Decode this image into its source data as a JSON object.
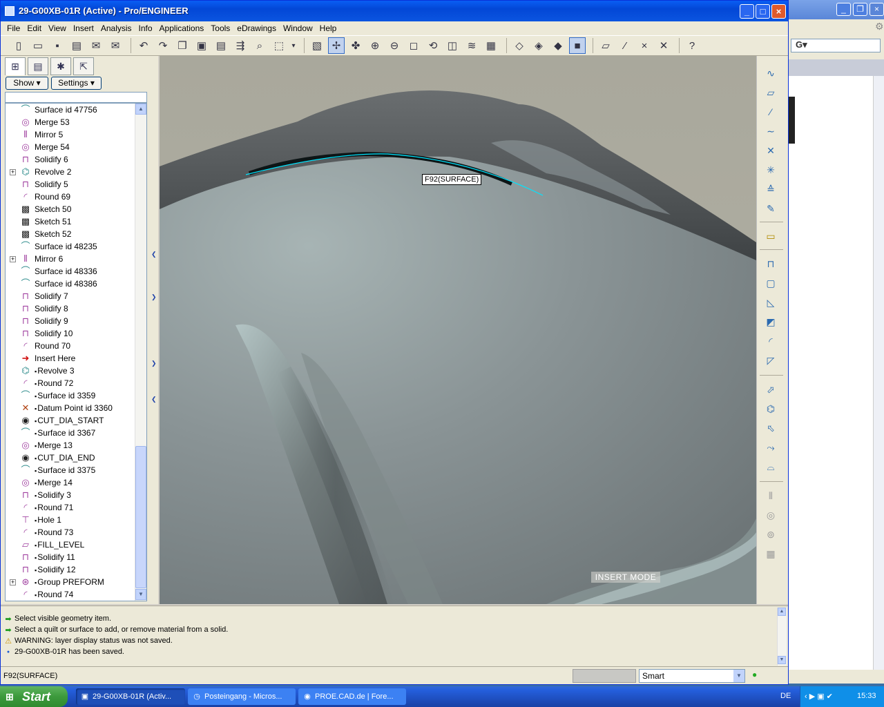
{
  "window": {
    "title": "29-G00XB-01R (Active) - Pro/ENGINEER"
  },
  "menu": [
    "File",
    "Edit",
    "View",
    "Insert",
    "Analysis",
    "Info",
    "Applications",
    "Tools",
    "eDrawings",
    "Window",
    "Help"
  ],
  "toolbar": {
    "icons": [
      "new-icon",
      "open-icon",
      "save-icon",
      "print-icon",
      "email-icon",
      "email-link-icon",
      "sep",
      "undo-icon",
      "redo-icon",
      "copy-icon",
      "paste-icon",
      "paste-special-icon",
      "regenerate-icon",
      "find-icon",
      "select-box-icon",
      "dropdown-icon",
      "sep",
      "repaint-icon",
      "spin-center-icon",
      "orient-icon",
      "zoom-in-icon",
      "zoom-out-icon",
      "refit-icon",
      "reorient-icon",
      "saved-views-icon",
      "layers-icon",
      "view-manager-icon",
      "sep",
      "wireframe-icon",
      "hidden-line-icon",
      "no-hidden-icon",
      "shading-icon",
      "sep",
      "datum-planes-icon",
      "datum-axes-icon",
      "datum-points-icon",
      "coordinate-systems-icon",
      "sep",
      "context-help-icon"
    ]
  },
  "left_panel": {
    "show_label": "Show",
    "settings_label": "Settings",
    "tree": [
      {
        "label": "Surface id 47756",
        "icon": "surface-icon",
        "expander": false,
        "marked": false
      },
      {
        "label": "Merge 53",
        "icon": "merge-icon",
        "expander": false,
        "marked": false
      },
      {
        "label": "Mirror 5",
        "icon": "mirror-icon",
        "expander": false,
        "marked": false
      },
      {
        "label": "Merge 54",
        "icon": "merge-icon",
        "expander": false,
        "marked": false
      },
      {
        "label": "Solidify 6",
        "icon": "solidify-icon",
        "expander": false,
        "marked": false
      },
      {
        "label": "Revolve 2",
        "icon": "revolve-icon",
        "expander": true,
        "marked": false
      },
      {
        "label": "Solidify 5",
        "icon": "solidify-icon",
        "expander": false,
        "marked": false
      },
      {
        "label": "Round 69",
        "icon": "round-icon",
        "expander": false,
        "marked": false
      },
      {
        "label": "Sketch 50",
        "icon": "sketch-icon",
        "expander": false,
        "marked": false
      },
      {
        "label": "Sketch 51",
        "icon": "sketch-icon",
        "expander": false,
        "marked": false
      },
      {
        "label": "Sketch 52",
        "icon": "sketch-icon",
        "expander": false,
        "marked": false
      },
      {
        "label": "Surface id 48235",
        "icon": "surface-icon",
        "expander": false,
        "marked": false
      },
      {
        "label": "Mirror 6",
        "icon": "mirror-icon",
        "expander": true,
        "marked": false
      },
      {
        "label": "Surface id 48336",
        "icon": "surface-icon",
        "expander": false,
        "marked": false
      },
      {
        "label": "Surface id 48386",
        "icon": "surface-icon",
        "expander": false,
        "marked": false
      },
      {
        "label": "Solidify 7",
        "icon": "solidify-icon",
        "expander": false,
        "marked": false
      },
      {
        "label": "Solidify 8",
        "icon": "solidify-icon",
        "expander": false,
        "marked": false
      },
      {
        "label": "Solidify 9",
        "icon": "solidify-icon",
        "expander": false,
        "marked": false
      },
      {
        "label": "Solidify 10",
        "icon": "solidify-icon",
        "expander": false,
        "marked": false
      },
      {
        "label": "Round 70",
        "icon": "round-icon",
        "expander": false,
        "marked": false
      },
      {
        "label": "Insert Here",
        "icon": "insert-arrow-icon",
        "expander": false,
        "marked": false
      },
      {
        "label": "Revolve 3",
        "icon": "revolve-icon",
        "expander": false,
        "marked": true
      },
      {
        "label": "Round 72",
        "icon": "round-icon",
        "expander": false,
        "marked": true
      },
      {
        "label": "Surface id 3359",
        "icon": "surface-icon",
        "expander": false,
        "marked": true
      },
      {
        "label": "Datum Point id 3360",
        "icon": "datum-point-icon",
        "expander": false,
        "marked": true
      },
      {
        "label": "CUT_DIA_START",
        "icon": "analysis-icon",
        "expander": false,
        "marked": true
      },
      {
        "label": "Surface id 3367",
        "icon": "surface-icon",
        "expander": false,
        "marked": true
      },
      {
        "label": "Merge 13",
        "icon": "merge-icon",
        "expander": false,
        "marked": true
      },
      {
        "label": "CUT_DIA_END",
        "icon": "analysis-icon",
        "expander": false,
        "marked": true
      },
      {
        "label": "Surface id 3375",
        "icon": "surface-icon",
        "expander": false,
        "marked": true
      },
      {
        "label": "Merge 14",
        "icon": "merge-icon",
        "expander": false,
        "marked": true
      },
      {
        "label": "Solidify 3",
        "icon": "solidify-icon",
        "expander": false,
        "marked": true
      },
      {
        "label": "Round 71",
        "icon": "round-icon",
        "expander": false,
        "marked": true
      },
      {
        "label": "Hole 1",
        "icon": "hole-icon",
        "expander": false,
        "marked": true
      },
      {
        "label": "Round 73",
        "icon": "round-icon",
        "expander": false,
        "marked": true
      },
      {
        "label": "FILL_LEVEL",
        "icon": "datum-plane-icon",
        "expander": false,
        "marked": true
      },
      {
        "label": "Solidify 11",
        "icon": "solidify-icon",
        "expander": false,
        "marked": true
      },
      {
        "label": "Solidify 12",
        "icon": "solidify-icon",
        "expander": false,
        "marked": true
      },
      {
        "label": "Group PREFORM",
        "icon": "group-icon",
        "expander": true,
        "marked": true
      },
      {
        "label": "Round 74",
        "icon": "round-icon",
        "expander": false,
        "marked": true
      }
    ]
  },
  "viewport": {
    "tooltip": "F92(SURFACE)",
    "mode_label": "INSERT MODE"
  },
  "right_toolbar": {
    "icons": [
      "sketched-datum-curve-icon",
      "datum-plane-icon",
      "datum-axis-icon",
      "datum-curve-icon",
      "datum-point-icon",
      "datum-coord-sys-icon",
      "analysis-feature-icon",
      "sketch-tool-icon",
      "note-icon",
      "extrude-icon",
      "shell-icon",
      "draft-icon",
      "rib-icon",
      "round-icon",
      "chamfer-icon",
      "sweep-icon",
      "revolve-icon",
      "blend-icon",
      "variable-sweep-icon",
      "boundary-blend-icon",
      "mirror-icon",
      "merge-icon",
      "intersect-icon",
      "pattern-icon"
    ]
  },
  "messages": [
    {
      "type": "info",
      "text": "Select visible geometry item."
    },
    {
      "type": "info",
      "text": "Select a quilt or surface to add, or remove material from a solid."
    },
    {
      "type": "warning",
      "text": "WARNING: layer display status was not saved."
    },
    {
      "type": "bullet",
      "text": "29-G00XB-01R has been saved."
    }
  ],
  "status": {
    "text": "F92(SURFACE)",
    "filter_value": "Smart"
  },
  "taskbar": {
    "start_label": "Start",
    "tasks": [
      {
        "label": "29-G00XB-01R (Activ...",
        "icon": "proe-icon",
        "active": true
      },
      {
        "label": "Posteingang - Micros...",
        "icon": "outlook-icon",
        "active": false
      },
      {
        "label": "PROE.CAD.de | Fore...",
        "icon": "firefox-icon",
        "active": false
      }
    ],
    "language": "DE",
    "clock": "15:33"
  },
  "colors": {
    "titlebar": "#0a5ef4",
    "selection_highlight": "#00e5ff",
    "model_surface": "#9aa6a6"
  }
}
